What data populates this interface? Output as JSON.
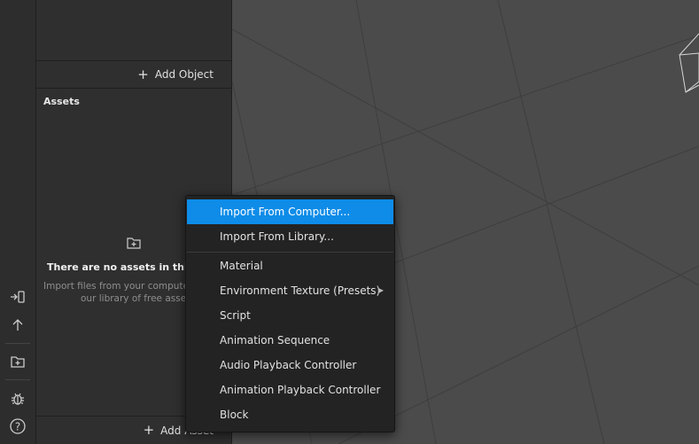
{
  "objects_panel": {
    "add_object_label": "Add Object"
  },
  "assets_panel": {
    "header": "Assets",
    "empty_title": "There are no assets in this proj",
    "empty_desc_line1": "Import files from your computer o",
    "empty_desc_line2": "our library of free assets.",
    "add_asset_label": "Add Asset"
  },
  "context_menu": {
    "items": [
      {
        "label": "Import From Computer...",
        "active": true
      },
      {
        "label": "Import From Library..."
      },
      {
        "label": "Material"
      },
      {
        "label": "Environment Texture (Presets)",
        "has_submenu": true
      },
      {
        "label": "Script"
      },
      {
        "label": "Animation Sequence"
      },
      {
        "label": "Audio Playback Controller"
      },
      {
        "label": "Animation Playback Controller"
      },
      {
        "label": "Block"
      }
    ]
  },
  "toolbar": {
    "icons": [
      "enter-icon",
      "upload-arrow-icon",
      "folder-add-icon",
      "bug-icon",
      "help-icon"
    ]
  },
  "colors": {
    "accent": "#0e8ce8",
    "panel": "#2f2f2f",
    "viewport": "#4b4b4b"
  }
}
